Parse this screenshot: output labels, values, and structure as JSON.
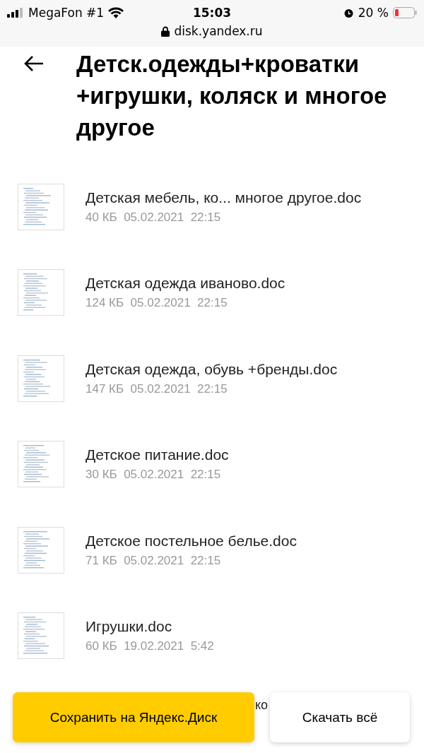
{
  "status_bar": {
    "carrier": "MegaFon #1",
    "time": "15:03",
    "battery": "20 %",
    "url": "disk.yandex.ru"
  },
  "header": {
    "title": "Детск.одежды+кроватки +игрушки, коляск и многое другое"
  },
  "files": [
    {
      "name": "Детская мебель, ко... многое другое.doc",
      "size": "40 КБ",
      "date": "05.02.2021",
      "time": "22:15"
    },
    {
      "name": "Детская одежда иваново.doc",
      "size": "124 КБ",
      "date": "05.02.2021",
      "time": "22:15"
    },
    {
      "name": "Детская одежда, обувь +бренды.doc",
      "size": "147 КБ",
      "date": "05.02.2021",
      "time": "22:15"
    },
    {
      "name": "Детское питание.doc",
      "size": "30 КБ",
      "date": "05.02.2021",
      "time": "22:15"
    },
    {
      "name": "Детское постельное белье.doc",
      "size": "71 КБ",
      "date": "05.02.2021",
      "time": "22:15"
    },
    {
      "name": "Игрушки.doc",
      "size": "60 КБ",
      "date": "19.02.2021",
      "time": "5:42"
    }
  ],
  "hidden_file_fragment": "ко",
  "buttons": [
    {
      "label": "Сохранить на Яндекс.Диск",
      "kind": "primary"
    },
    {
      "label": "Скачать всё",
      "kind": "secondary"
    }
  ]
}
